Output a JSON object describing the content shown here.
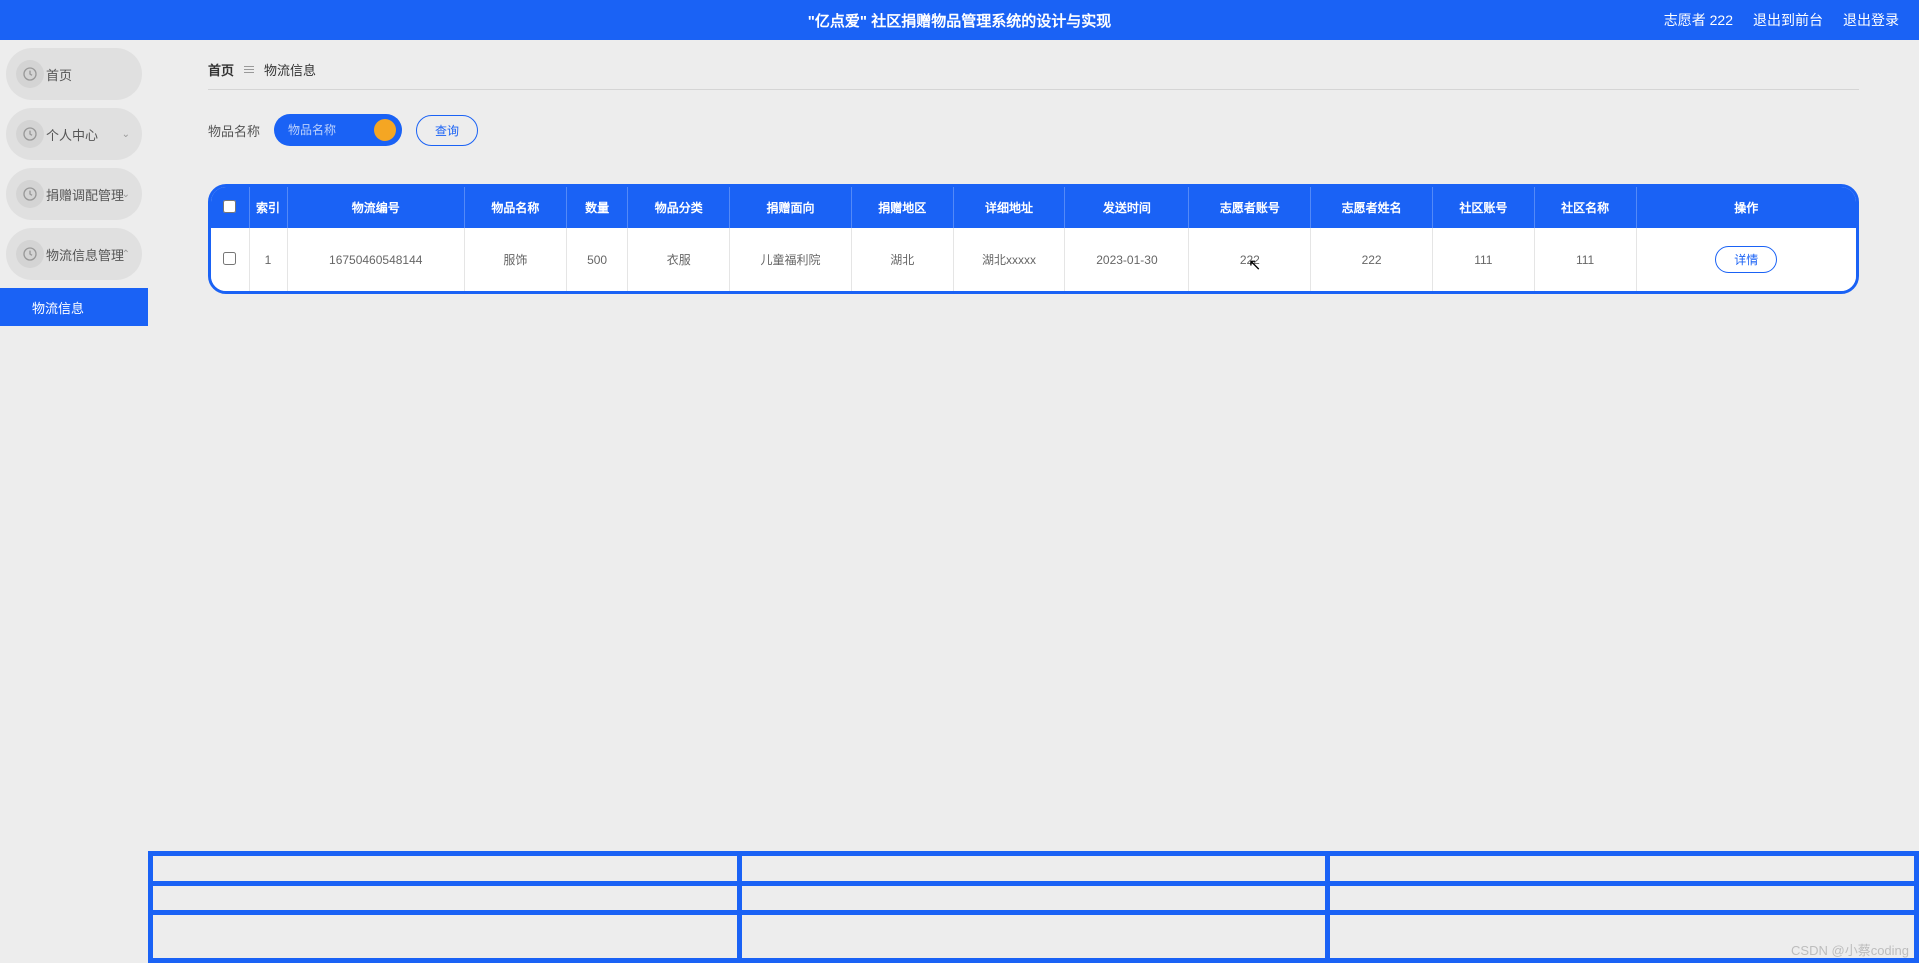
{
  "header": {
    "title": "\"亿点爱\" 社区捐赠物品管理系统的设计与实现",
    "user_role": "志愿者 222",
    "exit_front": "退出到前台",
    "logout": "退出登录"
  },
  "sidebar": {
    "items": [
      {
        "label": "首页",
        "expandable": false
      },
      {
        "label": "个人中心",
        "expandable": true
      },
      {
        "label": "捐赠调配管理",
        "expandable": true
      },
      {
        "label": "物流信息管理",
        "expandable": true,
        "expanded": true
      }
    ],
    "sub_active": "物流信息"
  },
  "breadcrumb": {
    "home": "首页",
    "current": "物流信息"
  },
  "search": {
    "label": "物品名称",
    "placeholder": "物品名称",
    "query_btn": "查询"
  },
  "table": {
    "columns": [
      "索引",
      "物流编号",
      "物品名称",
      "数量",
      "物品分类",
      "捐赠面向",
      "捐赠地区",
      "详细地址",
      "发送时间",
      "志愿者账号",
      "志愿者姓名",
      "社区账号",
      "社区名称",
      "操作"
    ],
    "rows": [
      {
        "index": "1",
        "logistics_no": "16750460548144",
        "item_name": "服饰",
        "quantity": "500",
        "category": "衣服",
        "target": "儿童福利院",
        "region": "湖北",
        "address": "湖北xxxxx",
        "send_time": "2023-01-30",
        "volunteer_account": "222",
        "volunteer_name": "222",
        "community_account": "111",
        "community_name": "111"
      }
    ],
    "detail_btn": "详情"
  },
  "watermark": "CSDN @小蔡coding"
}
